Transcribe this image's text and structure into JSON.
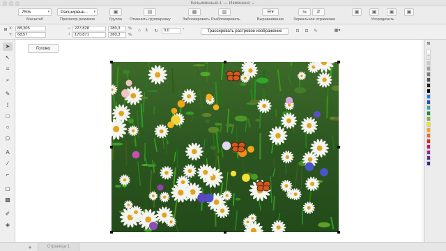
{
  "window": {
    "title": "Безымянный-1",
    "separator": "—",
    "status": "Изменено",
    "status_caret": "⌄"
  },
  "toolbar": {
    "zoom_value": "75%",
    "view_mode_value": "Расширенн...",
    "labels": {
      "zoom": "Масштаб",
      "view_mode": "Просмотр режимов",
      "group": "Группа",
      "ungroup": "Отменить группировку",
      "lock": "Заблокировать",
      "unlock": "Разблокировать",
      "align": "Выравнивание",
      "mirror": "Зеркальное отражение",
      "arrange": "Упорядочить"
    }
  },
  "propbar": {
    "x_label": "X:",
    "y_label": "Y:",
    "x": "88,305",
    "y": "68,57",
    "width": "227,828",
    "height": "170,871",
    "scale_w": "280,3",
    "scale_h": "280,3",
    "percent_label": "%",
    "angle": "0,0",
    "angle_unit": "°",
    "trace_button": "Трассировать растровое изображение"
  },
  "canvas": {
    "done_button": "Готово",
    "image_subject": "meadow of daisies and wildflowers with butterflies"
  },
  "pagebar": {
    "add_page": "+",
    "page_tab": "Страница 1"
  },
  "icons": [
    "pointer-icon",
    "shape-icon",
    "crop-icon",
    "zoom-icon",
    "freehand-icon",
    "rectangle-icon",
    "ellipse-icon",
    "polygon-icon",
    "text-icon",
    "line-icon",
    "connector-icon",
    "shadow-icon",
    "transparency-icon",
    "eyedropper-icon",
    "fill-icon"
  ],
  "palette_colors": [
    "#ffffff",
    "#e6e6e6",
    "#c8c8c8",
    "#a0a0a0",
    "#7a7a7a",
    "#505050",
    "#202020",
    "#000000",
    "#1b7fd6",
    "#1f4fb0",
    "#3aa6a0",
    "#1b8a3e",
    "#7ab534",
    "#ffe100",
    "#f7a11a",
    "#ef6a1d",
    "#e2231a",
    "#c0176a",
    "#8e2a8c",
    "#5b2d8c",
    "#2e3192"
  ]
}
